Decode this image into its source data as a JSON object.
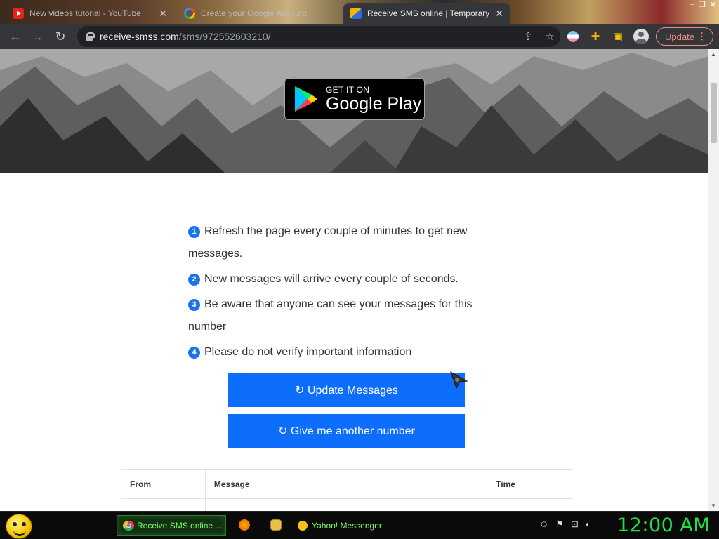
{
  "browser": {
    "tabs": [
      {
        "title": "New videos tutorial - YouTube",
        "icon": "youtube-icon"
      },
      {
        "title": "Create your Google Account",
        "icon": "google-icon"
      },
      {
        "title": "Receive SMS online | Temporary",
        "icon": "receive-sms-icon",
        "active": true
      }
    ],
    "url_domain": "receive-smss.com",
    "url_path": "/sms/972552603210/",
    "update_label": "Update"
  },
  "page": {
    "store_badge": {
      "small": "GET IT ON",
      "big": "Google Play"
    },
    "instructions": [
      {
        "num": "1",
        "text": "Refresh the page every couple of minutes to get new messages."
      },
      {
        "num": "2",
        "text": "New messages will arrive every couple of seconds."
      },
      {
        "num": "3",
        "text": "Be aware that anyone can see your messages for this number"
      },
      {
        "num": "4",
        "text": "Please do not verify important information"
      }
    ],
    "buttons": {
      "update": "↻ Update Messages",
      "another": "↻ Give me another number"
    },
    "table": {
      "headers": [
        "From",
        "Message",
        "Time"
      ]
    }
  },
  "taskbar": {
    "items": [
      {
        "label": "Receive SMS online ...",
        "active": true
      },
      {
        "label": "Yahoo! Messenger"
      }
    ],
    "clock": "12:00 AM"
  },
  "colors": {
    "accent": "#0d6efd",
    "number_badge": "#1a73e8",
    "clock": "#21e04a"
  }
}
